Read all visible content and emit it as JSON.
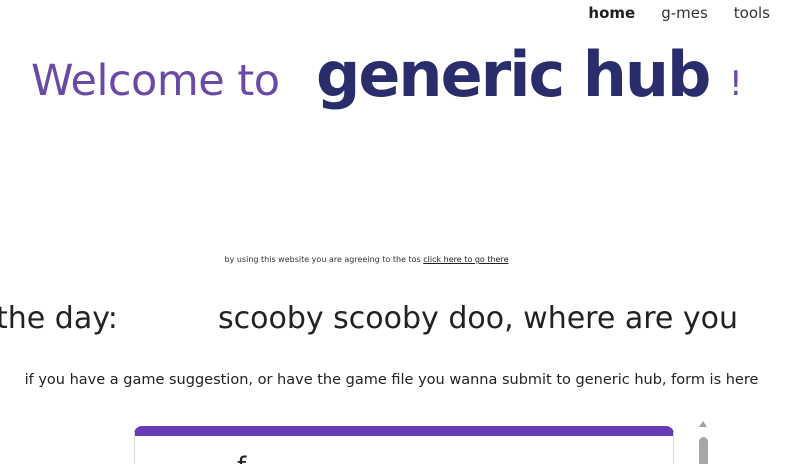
{
  "nav": {
    "items": [
      {
        "label": "home",
        "active": true
      },
      {
        "label": "g-mes",
        "active": false
      },
      {
        "label": "tools",
        "active": false
      }
    ]
  },
  "hero": {
    "welcome": "Welcome to",
    "brand": "generic hub",
    "exclaim": "!"
  },
  "tos": {
    "text": "by using this website you are agreeing to the tos",
    "link": "click here to go there"
  },
  "qotd": {
    "label": "the day:",
    "text": "scooby scooby doo, where are you"
  },
  "suggestion": {
    "text": "if you have a game suggestion, or have the game file you wanna submit to generic hub, form is here"
  },
  "form": {
    "glyph": "f",
    "accent": "#673ab7"
  },
  "colors": {
    "welcome": "#6a4aa6",
    "brand": "#2a2d6b"
  }
}
